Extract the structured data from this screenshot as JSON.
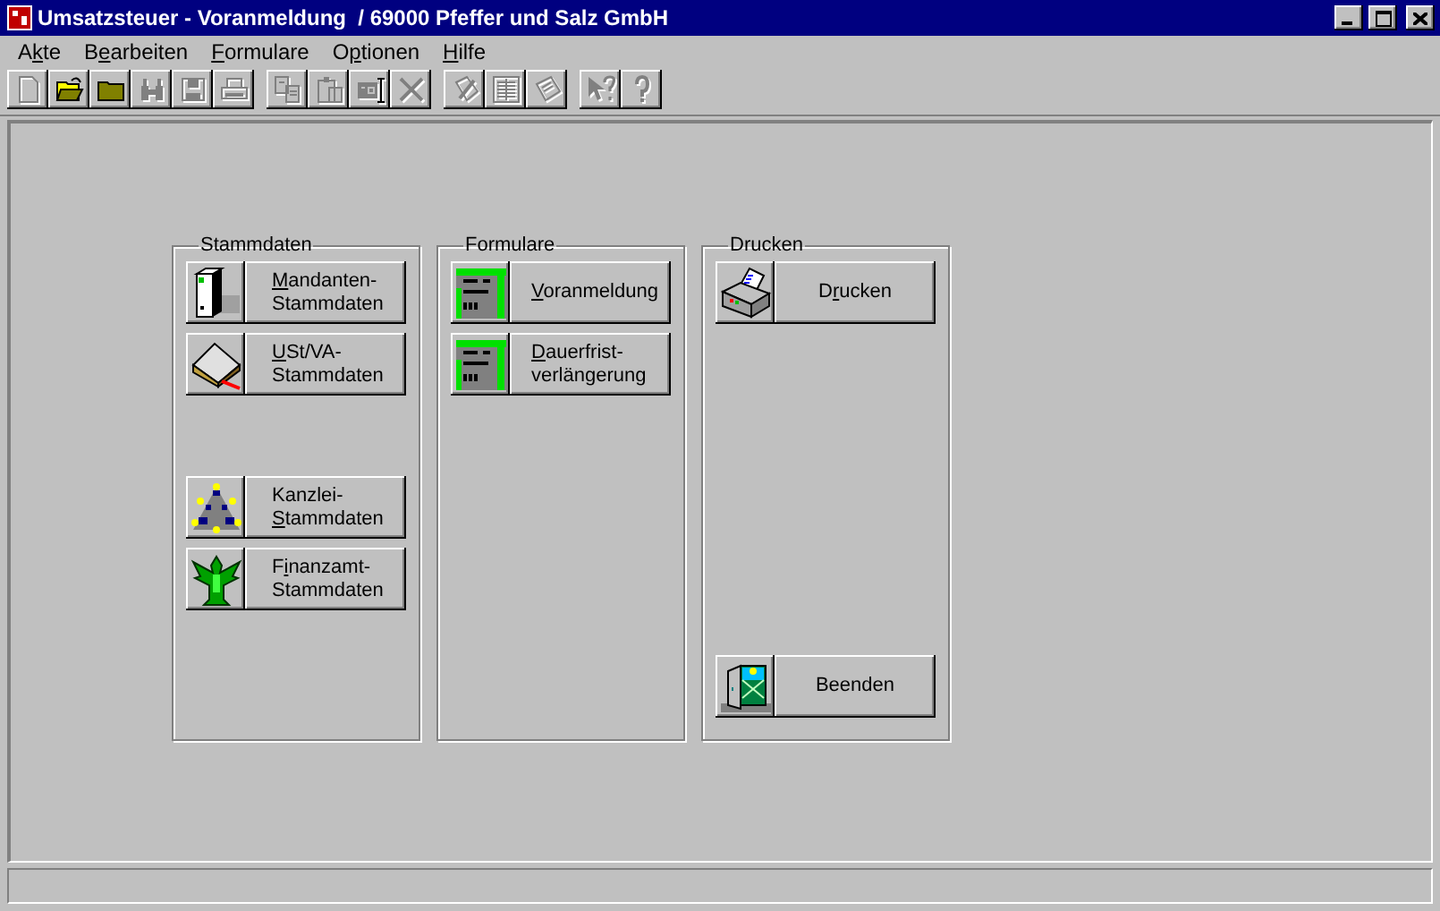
{
  "window": {
    "title": "Umsatzsteuer - Voranmeldung  / 69000 Pfeffer und Salz GmbH"
  },
  "menu": [
    {
      "pre": "A",
      "key": "k",
      "post": "te"
    },
    {
      "pre": "B",
      "key": "e",
      "post": "arbeiten"
    },
    {
      "key": "F",
      "post": "ormulare"
    },
    {
      "pre": "O",
      "key": "p",
      "post": "tionen"
    },
    {
      "key": "H",
      "post": "ilfe"
    }
  ],
  "toolbar": [
    [
      {
        "kind": "new",
        "disabled": true
      },
      {
        "kind": "open",
        "disabled": false
      },
      {
        "kind": "folder",
        "disabled": false
      },
      {
        "kind": "binoculars",
        "disabled": true
      },
      {
        "kind": "save",
        "disabled": true
      },
      {
        "kind": "print",
        "disabled": true
      }
    ],
    [
      {
        "kind": "copy",
        "disabled": true
      },
      {
        "kind": "paste",
        "disabled": true
      },
      {
        "kind": "rename",
        "disabled": true
      },
      {
        "kind": "delete",
        "disabled": true
      }
    ],
    [
      {
        "kind": "edit",
        "disabled": true
      },
      {
        "kind": "list",
        "disabled": true
      },
      {
        "kind": "notes",
        "disabled": true
      }
    ],
    [
      {
        "kind": "contexthelp",
        "disabled": true
      },
      {
        "kind": "help",
        "disabled": true
      }
    ]
  ],
  "groups": [
    {
      "title": "Stammdaten",
      "buttons": [
        {
          "kind": "binder",
          "lines": [
            {
              "key": "M",
              "post": "andanten-"
            },
            {
              "pre": "Stammdaten"
            }
          ]
        },
        {
          "kind": "book",
          "lines": [
            {
              "key": "U",
              "post": "St/VA-"
            },
            {
              "pre": "Stammdaten"
            }
          ]
        },
        {
          "kind": "office",
          "lines": [
            {
              "pre": "Kanzlei-"
            },
            {
              "key": "S",
              "post": "tammdaten"
            }
          ]
        },
        {
          "kind": "eagle",
          "lines": [
            {
              "pre": "F",
              "key": "i",
              "post": "nanzamt-"
            },
            {
              "pre": "Stammdaten"
            }
          ]
        }
      ]
    },
    {
      "title": "Formulare",
      "buttons": [
        {
          "kind": "form",
          "lines": [
            {
              "key": "V",
              "post": "oranmeldung"
            }
          ]
        },
        {
          "kind": "form",
          "lines": [
            {
              "key": "D",
              "post": "auerfrist-"
            },
            {
              "pre": "verlängerung"
            }
          ]
        }
      ]
    },
    {
      "title": "Drucken",
      "buttons": [
        {
          "kind": "printer",
          "lines": [
            {
              "pre": "D",
              "key": "r",
              "post": "ucken"
            }
          ]
        },
        {
          "kind": "door",
          "lines": [
            {
              "pre": "Beenden"
            }
          ]
        }
      ]
    }
  ]
}
